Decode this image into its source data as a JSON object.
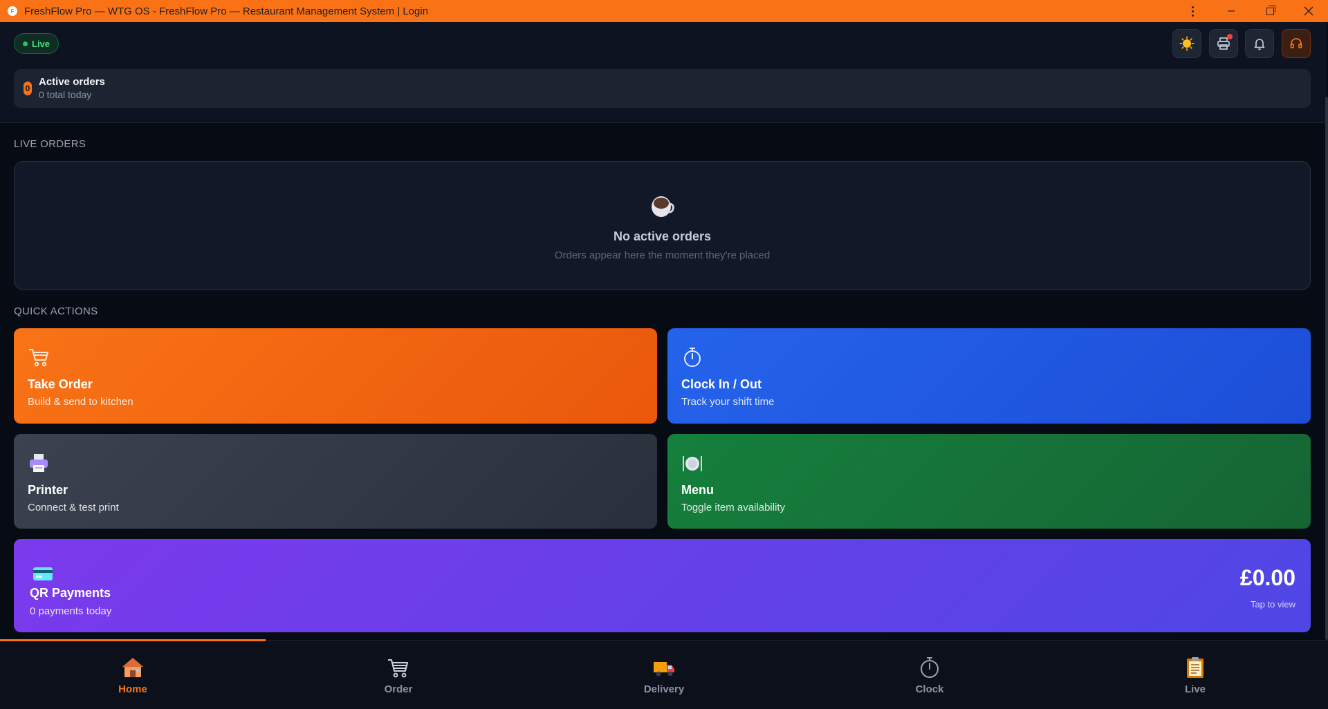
{
  "window": {
    "title": "FreshFlow Pro — WTG OS - FreshFlow Pro — Restaurant Management System | Login",
    "badge_letter": "F"
  },
  "header": {
    "live_label": "Live",
    "buttons": [
      "theme-sun-icon",
      "printer-icon",
      "bell-icon",
      "headset-icon"
    ]
  },
  "active_orders": {
    "count": "0",
    "title": "Active orders",
    "subtitle": "0 total today"
  },
  "live_orders": {
    "section_label": "LIVE ORDERS",
    "empty_title": "No active orders",
    "empty_subtitle": "Orders appear here the moment they're placed"
  },
  "quick_actions": {
    "section_label": "QUICK ACTIONS",
    "take_order": {
      "title": "Take Order",
      "subtitle": "Build & send to kitchen"
    },
    "clock": {
      "title": "Clock In / Out",
      "subtitle": "Track your shift time"
    },
    "printer": {
      "title": "Printer",
      "subtitle": "Connect & test print"
    },
    "menu": {
      "title": "Menu",
      "subtitle": "Toggle item availability"
    },
    "qr": {
      "title": "QR Payments",
      "subtitle": "0 payments today",
      "amount": "£0.00",
      "tap": "Tap to view"
    }
  },
  "nav": {
    "items": [
      {
        "label": "Home",
        "icon": "house-icon",
        "active": true
      },
      {
        "label": "Order",
        "icon": "cart-icon",
        "active": false
      },
      {
        "label": "Delivery",
        "icon": "truck-icon",
        "active": false
      },
      {
        "label": "Clock",
        "icon": "stopwatch-icon",
        "active": false
      },
      {
        "label": "Live",
        "icon": "clipboard-icon",
        "active": false
      }
    ]
  },
  "colors": {
    "accent": "#f97316",
    "live_green": "#22c55e",
    "clock_blue": "#2563eb",
    "menu_green": "#15803d",
    "qr_purple": "#7c3aed"
  }
}
